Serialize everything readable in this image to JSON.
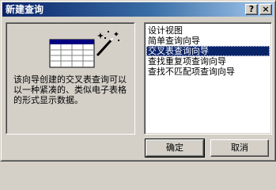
{
  "window": {
    "title": "新建查询",
    "help_label": "?",
    "close_label": "×"
  },
  "left_panel": {
    "description": "该向导创建的交叉表查询可以以一种紧凑的、类似电子表格的形式显示数据。",
    "illustration_icon": "crosstab-wizard-icon"
  },
  "query_types": {
    "items": [
      {
        "label": "设计视图"
      },
      {
        "label": "简单查询向导"
      },
      {
        "label": "交叉表查询向导"
      },
      {
        "label": "查找重复项查询向导"
      },
      {
        "label": "查找不匹配项查询向导"
      }
    ],
    "selected": "交叉表查询向导"
  },
  "buttons": {
    "ok_label": "确定",
    "cancel_label": "取消"
  },
  "colors": {
    "title_gradient_start": "#0a246a",
    "selection": "#0a246a",
    "face": "#d4d0c8"
  }
}
